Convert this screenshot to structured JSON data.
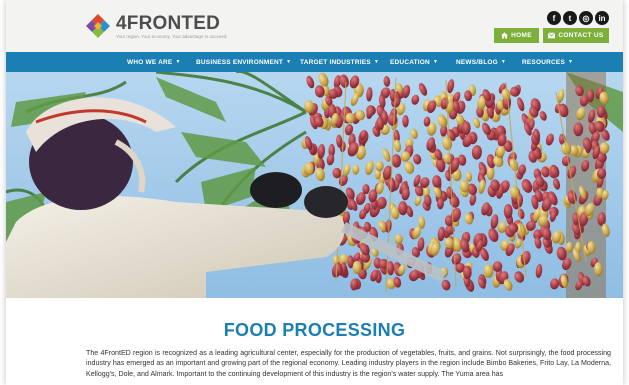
{
  "header": {
    "logo_text": "4FRONTED",
    "logo_tagline": "Your region. Your economy. Your advantage to succeed.",
    "socials": [
      {
        "icon": "facebook-icon",
        "glyph": "f"
      },
      {
        "icon": "twitter-icon",
        "glyph": "t"
      },
      {
        "icon": "instagram-icon",
        "glyph": "◎"
      },
      {
        "icon": "linkedin-icon",
        "glyph": "in"
      }
    ],
    "home_label": "HOME",
    "contact_label": "CONTACT US",
    "accent_color": "#7db03b"
  },
  "nav": {
    "color": "#1b7fb4",
    "items": [
      {
        "label": "WHO WE ARE"
      },
      {
        "label": "BUSINESS ENVIRONMENT"
      },
      {
        "label": "TARGET INDUSTRIES"
      },
      {
        "label": "EDUCATION"
      },
      {
        "label": "NEWS/BLOG"
      },
      {
        "label": "RESOURCES"
      }
    ]
  },
  "hero": {
    "alt": "Worker harvesting dates from a palm tree"
  },
  "content": {
    "title": "FOOD PROCESSING",
    "paragraph": "The 4FrontED region is recognized as a leading agricultural center, especially for the production of vegetables, fruits, and grains. Not surprisingly, the food processing industry has emerged as an important and growing part of the regional economy. Leading industry players in the region include Bimbo Bakeries, Frito Lay, La Moderna, Kellogg's, Dole, and Almark.   Important to the continuing development of this industry is the region's water supply. The Yuma area has"
  }
}
